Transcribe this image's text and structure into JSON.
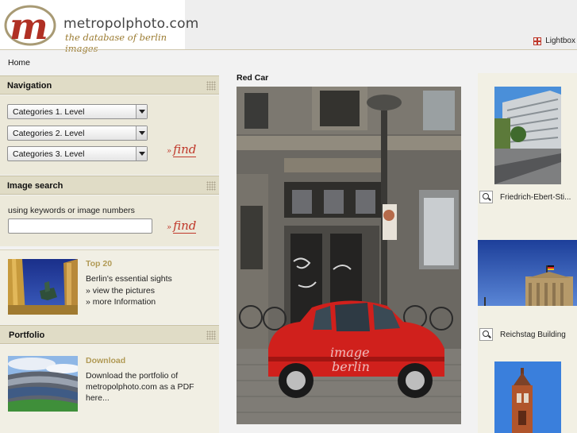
{
  "header": {
    "logo_letter": "m",
    "site_name": "metropolphoto.com",
    "tagline": "the database of berlin images",
    "lightbox_label": "Lightbox",
    "lightbox_icon": "grid-icon",
    "accent_color": "#c0392b",
    "brand_gold": "#9a7a2f"
  },
  "breadcrumb": {
    "home": "Home"
  },
  "navigation": {
    "title": "Navigation",
    "selects": [
      {
        "selected": "Categories 1. Level"
      },
      {
        "selected": "Categories 2. Level"
      },
      {
        "selected": "Categories 3. Level"
      }
    ],
    "find_raquo": "»",
    "find_label": "find"
  },
  "image_search": {
    "title": "Image search",
    "hint": "using keywords or image numbers",
    "input_value": "",
    "input_placeholder": "",
    "find_raquo": "»",
    "find_label": "find"
  },
  "top20": {
    "title": "Top 20",
    "subtitle": "Berlin's essential sights",
    "link1": "» view the pictures",
    "link2": "» more Information"
  },
  "portfolio": {
    "title": "Portfolio",
    "download_title": "Download",
    "text_line1": "Download the portfolio of",
    "text_line2": "metropolphoto.com as a PDF",
    "text_line3": "here..."
  },
  "main_photo": {
    "title": "Red Car",
    "watermark_line1": "image",
    "watermark_line2": "berlin"
  },
  "thumbnails": [
    {
      "caption": "Friedrich-Ebert-Sti..."
    },
    {
      "caption": "Reichstag Building"
    },
    {
      "caption": ""
    }
  ]
}
